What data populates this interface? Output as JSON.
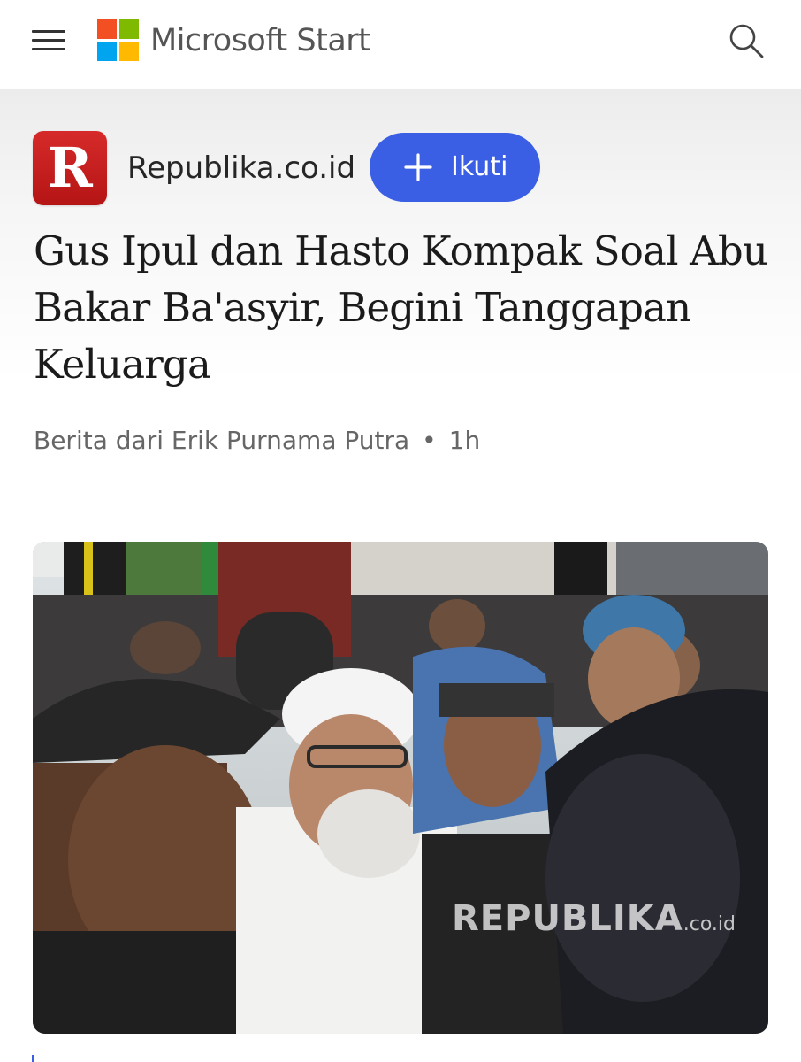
{
  "app": {
    "title": "Microsoft Start",
    "logo_colors": [
      "#f25022",
      "#7fba00",
      "#00a4ef",
      "#ffb900"
    ]
  },
  "topbar": {
    "menu_icon": "hamburger-menu-icon",
    "search_icon": "search-icon"
  },
  "publisher": {
    "name": "Republika.co.id",
    "logo_letter": "R",
    "logo_color": "#d62a2a",
    "follow_label": "Ikuti",
    "follow_icon": "plus-icon",
    "accent": "#3a5fe5"
  },
  "article": {
    "headline": "Gus Ipul dan Hasto Kompak Soal Abu Bakar Ba'asyir, Begini Tanggapan Keluarga",
    "byline": "Berita dari Erik Purnama Putra",
    "separator": "•",
    "age": "1h"
  },
  "image": {
    "watermark": "REPUBLIKA",
    "watermark_suffix": ".co.id"
  }
}
